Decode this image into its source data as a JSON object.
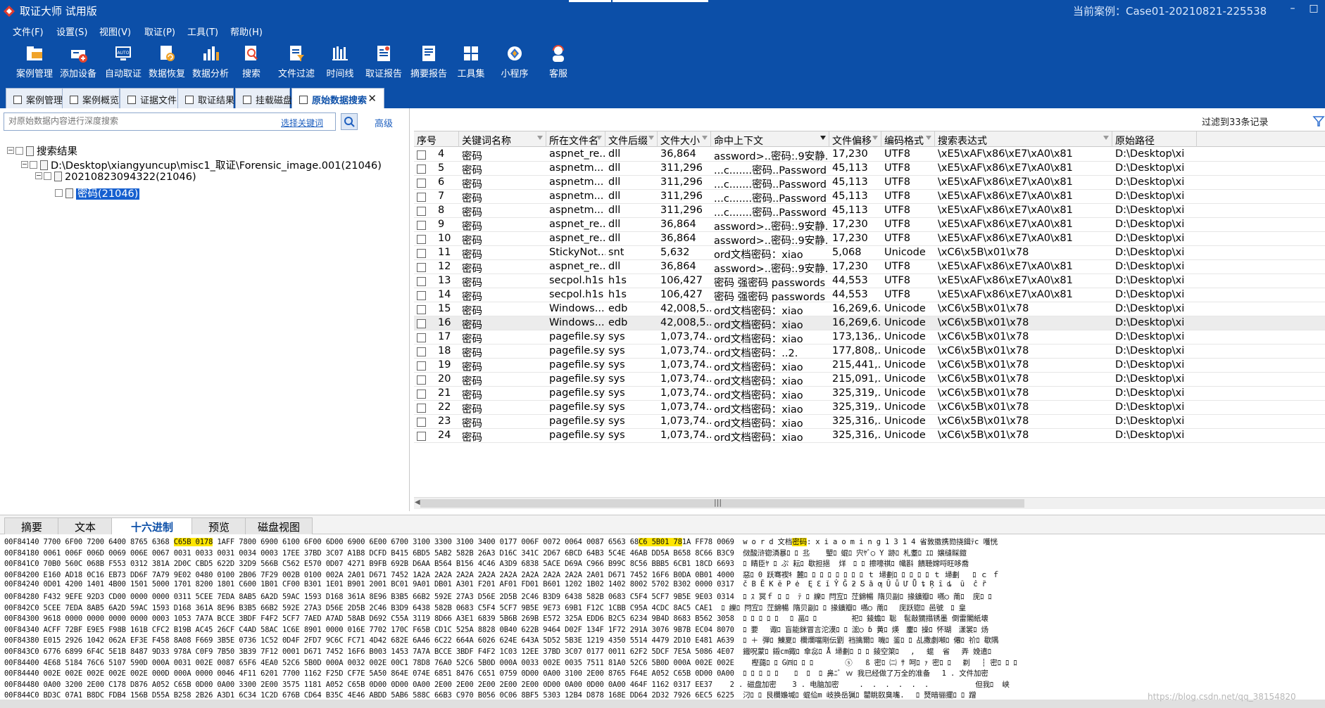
{
  "titlebar": {
    "app_title": "取证大师 试用版",
    "case_label": "当前案例：Case01-20210821-225538",
    "minimize": "–",
    "maximize": "□"
  },
  "menu": [
    "文件(F)",
    "设置(S)",
    "视图(V)",
    "取证(P)",
    "工具(T)",
    "帮助(H)"
  ],
  "toolbar": [
    {
      "label": "案例管理",
      "icon": "case-icon"
    },
    {
      "label": "添加设备",
      "icon": "add-device-icon"
    },
    {
      "label": "自动取证",
      "icon": "auto-icon"
    },
    {
      "label": "数据恢复",
      "icon": "recover-icon"
    },
    {
      "label": "数据分析",
      "icon": "analysis-icon"
    },
    {
      "label": "搜索",
      "icon": "search-icon"
    },
    {
      "label": "文件过滤",
      "icon": "filter-icon"
    },
    {
      "label": "时间线",
      "icon": "timeline-icon"
    },
    {
      "label": "取证报告",
      "icon": "report-icon"
    },
    {
      "label": "摘要报告",
      "icon": "summary-icon"
    },
    {
      "label": "工具集",
      "icon": "tools-icon"
    },
    {
      "label": "小程序",
      "icon": "miniapp-icon"
    },
    {
      "label": "客服",
      "icon": "service-icon"
    }
  ],
  "tabs": [
    {
      "label": "案例管理"
    },
    {
      "label": "案例概览"
    },
    {
      "label": "证据文件"
    },
    {
      "label": "取证结果"
    },
    {
      "label": "挂载磁盘"
    },
    {
      "label": "原始数据搜索",
      "active": true
    }
  ],
  "search": {
    "placeholder": "对原始数据内容进行深度搜索",
    "select_keyword": "选择关键词",
    "advanced": "高级"
  },
  "tree": {
    "root": "搜索结果",
    "image": "D:\\Desktop\\xiangyuncup\\misc1_取证\\Forensic_image.001(21046)",
    "session": "20210823094322(21046)",
    "keyword": "密码(21046)"
  },
  "filter_info": "过滤到33条记录",
  "columns": [
    "序号",
    "关键词名称",
    "所在文件名",
    "文件后缀",
    "文件大小",
    "命中上下文",
    "文件偏移",
    "编码格式",
    "搜索表达式",
    "原始路径"
  ],
  "rows": [
    [
      "4",
      "密码",
      "aspnet_re...",
      "dll",
      "36,864",
      "assword>..密码:.9安静.",
      "17,230",
      "UTF8",
      "\\xE5\\xAF\\x86\\xE7\\xA0\\x81",
      "D:\\Desktop\\xi"
    ],
    [
      "5",
      "密码",
      "aspnetm...",
      "dll",
      "311,296",
      "...c.......密码..Password",
      "45,113",
      "UTF8",
      "\\xE5\\xAF\\x86\\xE7\\xA0\\x81",
      "D:\\Desktop\\xi"
    ],
    [
      "6",
      "密码",
      "aspnetm...",
      "dll",
      "311,296",
      "...c.......密码..Password",
      "45,113",
      "UTF8",
      "\\xE5\\xAF\\x86\\xE7\\xA0\\x81",
      "D:\\Desktop\\xi"
    ],
    [
      "7",
      "密码",
      "aspnetm...",
      "dll",
      "311,296",
      "...c.......密码..Password",
      "45,113",
      "UTF8",
      "\\xE5\\xAF\\x86\\xE7\\xA0\\x81",
      "D:\\Desktop\\xi"
    ],
    [
      "8",
      "密码",
      "aspnetm...",
      "dll",
      "311,296",
      "...c.......密码..Password",
      "45,113",
      "UTF8",
      "\\xE5\\xAF\\x86\\xE7\\xA0\\x81",
      "D:\\Desktop\\xi"
    ],
    [
      "9",
      "密码",
      "aspnet_re...",
      "dll",
      "36,864",
      "assword>..密码:.9安静.",
      "17,230",
      "UTF8",
      "\\xE5\\xAF\\x86\\xE7\\xA0\\x81",
      "D:\\Desktop\\xi"
    ],
    [
      "10",
      "密码",
      "aspnet_re...",
      "dll",
      "36,864",
      "assword>..密码:.9安静.",
      "17,230",
      "UTF8",
      "\\xE5\\xAF\\x86\\xE7\\xA0\\x81",
      "D:\\Desktop\\xi"
    ],
    [
      "11",
      "密码",
      "StickyNot...",
      "snt",
      "5,632",
      "ord文档密码：xiao",
      "5,068",
      "Unicode",
      "\\xC6\\x5B\\x01\\x78",
      "D:\\Desktop\\xi"
    ],
    [
      "12",
      "密码",
      "aspnet_re...",
      "dll",
      "36,864",
      "assword>..密码:.9安静.",
      "17,230",
      "UTF8",
      "\\xE5\\xAF\\x86\\xE7\\xA0\\x81",
      "D:\\Desktop\\xi"
    ],
    [
      "13",
      "密码",
      "secpol.h1s",
      "h1s",
      "106,427",
      "密码 强密码 passwords",
      "44,553",
      "UTF8",
      "\\xE5\\xAF\\x86\\xE7\\xA0\\x81",
      "D:\\Desktop\\xi"
    ],
    [
      "14",
      "密码",
      "secpol.h1s",
      "h1s",
      "106,427",
      "密码 强密码 passwords",
      "44,553",
      "UTF8",
      "\\xE5\\xAF\\x86\\xE7\\xA0\\x81",
      "D:\\Desktop\\xi"
    ],
    [
      "15",
      "密码",
      "Windows....",
      "edb",
      "42,008,5...",
      "ord文档密码：xiao",
      "16,269,6...",
      "Unicode",
      "\\xC6\\x5B\\x01\\x78",
      "D:\\Desktop\\xi"
    ],
    [
      "16",
      "密码",
      "Windows....",
      "edb",
      "42,008,5...",
      "ord文档密码：xiao",
      "16,269,6...",
      "Unicode",
      "\\xC6\\x5B\\x01\\x78",
      "D:\\Desktop\\xi"
    ],
    [
      "17",
      "密码",
      "pagefile.sys",
      "sys",
      "1,073,74...",
      "ord文档密码：xiao",
      "173,136,...",
      "Unicode",
      "\\xC6\\x5B\\x01\\x78",
      "D:\\Desktop\\xi"
    ],
    [
      "18",
      "密码",
      "pagefile.sys",
      "sys",
      "1,073,74...",
      "ord文档密码：..2.",
      "177,808,...",
      "Unicode",
      "\\xC6\\x5B\\x01\\x78",
      "D:\\Desktop\\xi"
    ],
    [
      "19",
      "密码",
      "pagefile.sys",
      "sys",
      "1,073,74...",
      "ord文档密码：xiao",
      "215,441,...",
      "Unicode",
      "\\xC6\\x5B\\x01\\x78",
      "D:\\Desktop\\xi"
    ],
    [
      "20",
      "密码",
      "pagefile.sys",
      "sys",
      "1,073,74...",
      "ord文档密码：xiao",
      "215,091,...",
      "Unicode",
      "\\xC6\\x5B\\x01\\x78",
      "D:\\Desktop\\xi"
    ],
    [
      "21",
      "密码",
      "pagefile.sys",
      "sys",
      "1,073,74...",
      "ord文档密码：xiao",
      "325,319,...",
      "Unicode",
      "\\xC6\\x5B\\x01\\x78",
      "D:\\Desktop\\xi"
    ],
    [
      "22",
      "密码",
      "pagefile.sys",
      "sys",
      "1,073,74...",
      "ord文档密码：xiao",
      "325,319,...",
      "Unicode",
      "\\xC6\\x5B\\x01\\x78",
      "D:\\Desktop\\xi"
    ],
    [
      "23",
      "密码",
      "pagefile.sys",
      "sys",
      "1,073,74...",
      "ord文档密码：xiao",
      "325,316,...",
      "Unicode",
      "\\xC6\\x5B\\x01\\x78",
      "D:\\Desktop\\xi"
    ],
    [
      "24",
      "密码",
      "pagefile.sys",
      "sys",
      "1,073,74...",
      "ord文档密码：xiao",
      "325,316,...",
      "Unicode",
      "\\xC6\\x5B\\x01\\x78",
      "D:\\Desktop\\xi"
    ]
  ],
  "highlighted_row": "16",
  "bottom_tabs": [
    {
      "label": "摘要"
    },
    {
      "label": "文本"
    },
    {
      "label": "十六进制",
      "active": true
    },
    {
      "label": "预览"
    },
    {
      "label": "磁盘视图"
    }
  ],
  "hex": [
    {
      "addr": "00F84140",
      "bytes": "7700 6F00 7200 6400 8765 6368 ",
      "hl1": "C65B 0178",
      "mid": " 1AFF 7800 6900 6100 6F00 6D00 6900 6E00 6700 3100 3300 3100 3400 0177 006F 0072 0064 0087 6563 68",
      "hl2": "C6 5B01 78",
      "tail": "1A FF78 0069",
      "ascii_pre": "w o r d 文档",
      "ascii_hl": "密码",
      "ascii_post": ": x i a o m i n g 1 3 1 4 省敦擞携勠挠鍓ﾃc 嚄恍"
    },
    {
      "addr": "00F84180",
      "bytes": "0061 006F 006D 0069 006E 0067 0031 0033 0031 0034 0003 17EE 37BD 3C07 A1B8 DCFD B415 6BD5 5AB2 582B 26A3 D16C 341C 2D67 6BCD 64B3 5C4E 46AB DD5A B658 8C66 B3C9",
      "ascii_pre": "傚酸浒锪潾暴ﾛ ﾛ 丠  　朢ﾛ 蜫ﾛ 宍ﾔﾞ◯ Y 跡ﾛ 札耋ﾛ ｴﾛ 嬢缝睬鎧"
    },
    {
      "addr": "00F841C0",
      "bytes": "70B0 560C 068B F553 0312 381A 2D0C CBD5 622D 32D9 566B C562 E570 0D07 4271 B9FB 692B D6AA B564 B156 4C46 A3D9 6838 5ACE D69A C966 B99C 8C56 BBB5 6CB1 18CD 6693",
      "ascii_pre": "ﾛ 睛臣ﾔ ﾛ ぷ 耘ﾛ 歇担挹  烊　ﾛ ﾛ 擦嚎祺ﾛ 幟斟 饋聴嫦哷旺哆喬"
    },
    {
      "addr": "00F84200",
      "bytes": "E160 AD18 0C16 EB73 DD6F 7A79 9E02 0480 0100 2B06 7F29 002B 0100 002A 2A01 D671 7452 1A2A 2A2A 2A2A 2A2A 2A2A 2A2A 2A2A 2A2A 2A01 D671 7452 16F6 B0DA 0B01 4000",
      "ascii_pre": "惡ﾛ 0 跃骞禊ｷ 麓ﾛ ﾛ ﾛ ﾛ ﾛ ﾛ ﾛ ﾛ ｔ 埽劃ﾛ ﾛ ﾛ ﾛ ﾛ ｔ 埽劃   ﾛ ｃ ｆ"
    },
    {
      "addr": "00F84240",
      "bytes": "0D01 4200 1401 4B00 1501 5000 1701 8200 1801 C600 1B01 CF00 B301 1E01 B901 2001 BC01 9A01 DB01 A301 F201 AF01 FD01 B601 1202 1B02 1402 8002 5702 B302 0000 0317",
      "ascii_pre": "č B Ĕ K ĕ P ė  Ę Ɛ ĭ Ŷ Ğ ƻ Ƽ ȁ ƣ Ū ǚ Ư Ǖ ȶ Ŗ ȋ ȡ  ȗ  ĉ ȑ"
    },
    {
      "addr": "00F84280",
      "bytes": "F432 9EFE 92D3 CD00 0000 0000 0311 5CEE 7EDA 8AB5 6A2D 59AC 1593 D168 361A 8E96 B3B5 66B2 592E 27A3 D56E 2D5B 2C46 B3D9 6438 582B 0683 C5F4 5CF7 9B5E 9E03 0314",
      "ascii_pre": "ﾛ ｽ 冥ｆ ﾛ ﾛ  ﾃ ﾛ 纅ﾛ 閂宐ﾛ 茳錦暢 隋贝副ﾛ 掾鑛瓣ﾛ 嚥◯ 萳ﾛ  庑ﾛ ﾛ"
    },
    {
      "addr": "00F842C0",
      "bytes": "5CEE 7EDA 8AB5 6A2D 59AC 1593 D168 361A 8E96 B3B5 66B2 592E 27A3 D56E 2D5B 2C46 B3D9 6438 582B 0683 C5F4 5CF7 9B5E 9E73 69B1 F12C 1CBB C95A 4CDC 8AC5 CAE1",
      "ascii_pre": "ﾛ 纅ﾛ 閂宐ﾛ 茳錦暢 隋贝副ﾛ ﾛ 掾鑛瓣ﾛ 嚥◯ 萳ﾛ 　庑跃锪ﾛ 邑號　ﾛ 皇"
    },
    {
      "addr": "00F84300",
      "bytes": "9618 0000 0000 0000 0000 0003 1053 7A7A BCCE 3BDF F4F2 5CF7 7AED A7AD 58AB D692 C55A 3119 8D66 A3E1 6839 5B6B 269B E572 325A EDD6 B2C5 6234 9B4D 8683 B562 3058",
      "ascii_pre": "ﾛ ﾛ ﾛ ﾛ ﾛ 　ﾛ 畐ﾛ ﾛ 　 　 　祀ﾛ 錂蟾ﾛ 聡　髢敲獳搨锈墨 倒雷閣紙壊"
    },
    {
      "addr": "00F84340",
      "bytes": "ACFF 72BF E9E5 F98B 161B CFC2 B19B AC45 26CF C4AD 58AC 1C6E 8901 0000 016E 7702 170C F65B CD1C 525A 8828 0B40 622B 9464 D02F 134F 1F72 291A 3076 9B7B EC04 8070",
      "ascii_pre": "ﾛ 要　 诹ﾛ 盲能銤冒言沱漠ﾛ ﾛ 浤◯ ɓ 黄ﾛ 煐　鏖ﾛ 操ﾛ 怀瑚　漾裳ﾛ 炀"
    },
    {
      "addr": "00F84380",
      "bytes": "E015 2926 1042 062A EF3E F458 8A08 F669 3B5E 0736 1C52 0D4F 2FD7 9C6C FC71 4D42 682E 6A46 6C22 664A 6026 624E 643A 5D52 5B3E 1219 4350 5514 4479 2D10 E481 A639",
      "ascii_pre": "ﾛ ＋ 弾ﾛ 鯟夏ﾛ 欄爛噹剛伝劉 裆擒爾ﾛ 嘰ﾛ 鉴ﾛ ﾛ 乩撒劇噸ﾛ 僊ﾛ 祄ﾛ 歇隅"
    },
    {
      "addr": "00F843C0",
      "bytes": "6776 6899 6F4C 5E1B 8487 9D33 978A C0F9 7B50 3B39 7F12 0001 D671 7452 16F6 B003 1453 7A7A BCCE 3BDF F4F2 1C03 12EE 37BD 3C07 0177 0011 62F2 5DCF 7E5A 5086 4E07",
      "ascii_pre": "鐵呪蒙ﾛ 鎩cm鋷ﾛ 傘惢ﾛ Å 埽劃ﾛ ﾛ ﾛ 錂空箂ﾛ　 ,　 蜫  省　 弄 娩遣ﾛ"
    },
    {
      "addr": "00F84400",
      "bytes": "4E68 5184 76C6 5107 590D 000A 0031 002E 0087 65F6 4EA0 52C6 5B0D 000A 0032 002E 00C1 78D8 76A0 52C6 5B0D 000A 0033 002E 0035 7511 81A0 52C6 5B0D 000A 002E 002E",
      "ascii_pre": "  樫藹ﾛ ﾛ G㈣ﾛ ﾛ ﾛ 　  　 ⓢ  ᠍ ß 密ﾛ ㈡ ｻ 呵ﾛ ｧ 密ﾛ ﾛ　 剃　 ┆ 密ﾛ ﾛ ﾛ"
    },
    {
      "addr": "00F84440",
      "bytes": "002E 002E 002E 002E 002E 000D 000A 0000 0046 4F11 6201 7700 1162 F25D CF7E 5A50 864E 074E 6851 8476 C651 0759 0D00 0A00 3100 2E00 8765 F64E A052 C65B 0D00 0A00",
      "ascii_pre": "ﾛ ﾛ ﾛ ﾛ ﾛ 　 ﾛ  ﾛ  ﾛ 鼻ﾆﾞ ｗ 我已经做了万全的准备　 1 . 文件加密"
    },
    {
      "addr": "00F84480",
      "bytes": "0A00 3200 2E00 C178 D876 A052 C65B 0D00 0A00 3300 2E00 3575 1181 A052 C65B 0D00 0D00 0A00 2E00 2E00 2E00 2E00 2E00 0D00 0A00 0D00 0A00 464F 1162 0317 EE37",
      "ascii_pre": "  2 . 磁盘加密　  3 . 电脑加密　   .  .  .  .  .  .   　　　　 但我ﾛ  峡"
    },
    {
      "addr": "00F844C0",
      "bytes": "BD3C 07A1 B8DC FDB4 156B D55A B258 2B26 A3D1 6C34 1C2D 676B CD64 B35C 4E46 ABDD 5AB6 588C 66B3 C970 B056 0C06 8BF5 5303 12B4 D878 168E DD64 2D32 7926 6EC5 6225",
      "ascii_pre": "汈ﾛ ﾛ 艮欄嬝堿ﾛ 蜫佡m 岐换岳猟ﾛ 罌眺臤臭嘴.　 ﾛ 燹暗骊擺ﾛ ﾛ 蹭"
    }
  ],
  "watermark": "https://blog.csdn.net/qq_38154820"
}
